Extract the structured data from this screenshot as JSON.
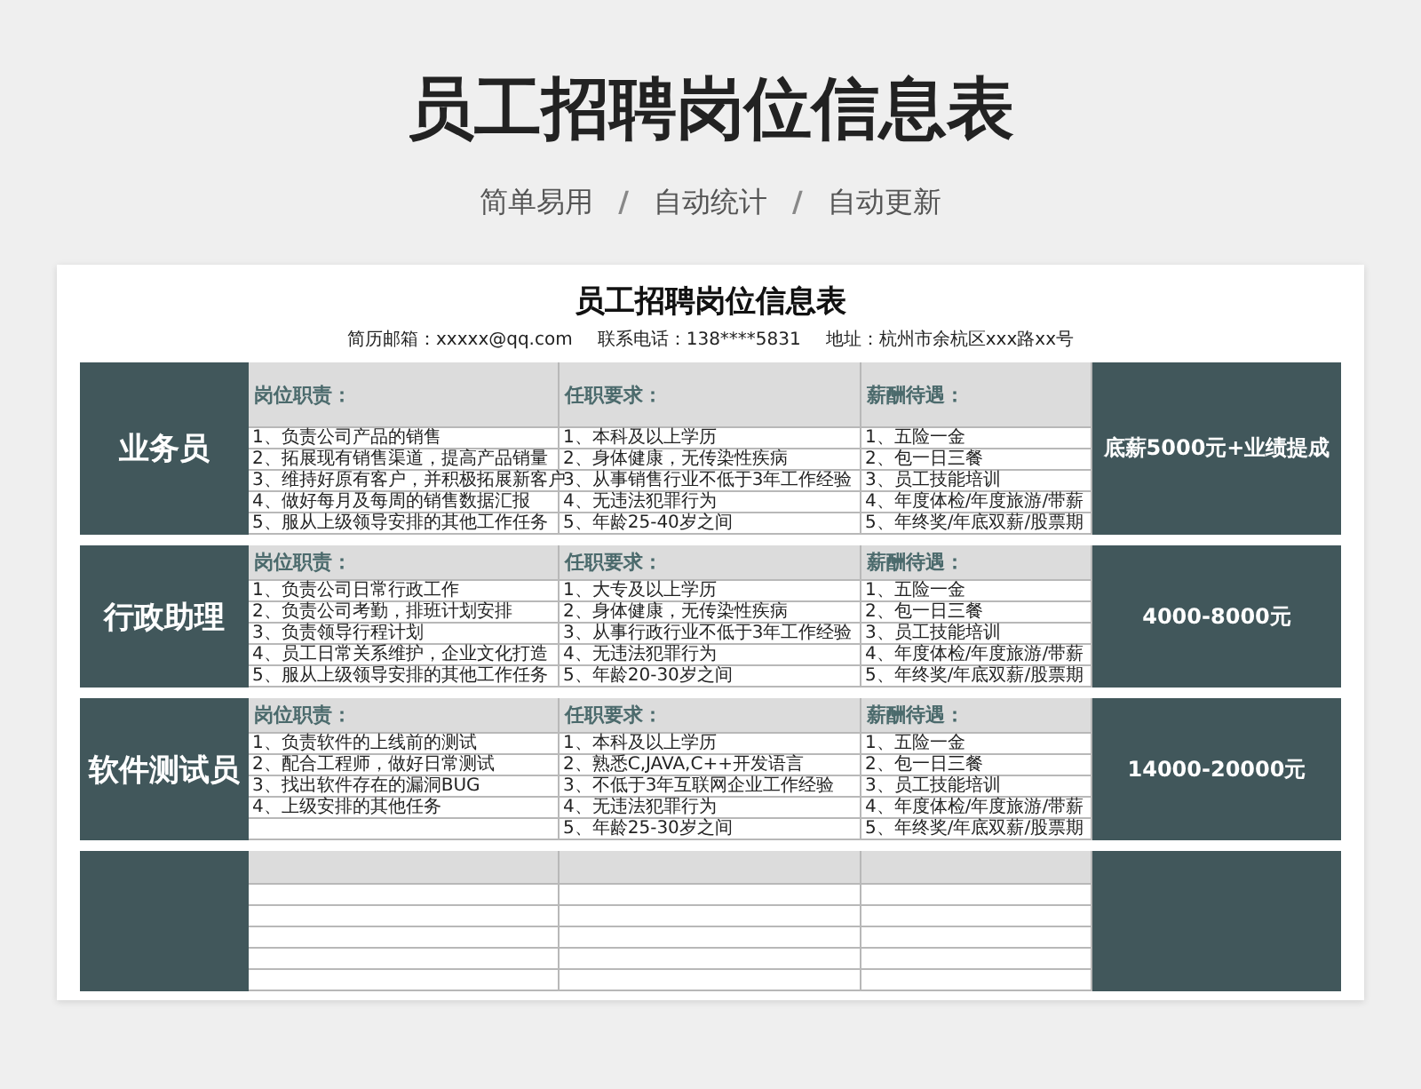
{
  "title": "员工招聘岗位信息表",
  "subtitle": [
    {
      "kind": "feature",
      "text": "简单易用"
    },
    {
      "kind": "separator",
      "text": "/"
    },
    {
      "kind": "feature",
      "text": "自动统计"
    },
    {
      "kind": "separator",
      "text": "/"
    },
    {
      "kind": "feature",
      "text": "自动更新"
    }
  ],
  "sheet": {
    "title": "员工招聘岗位信息表",
    "contact": [
      "简历邮箱：xxxxx@qq.com",
      "联系电话：138****5831",
      "地址：杭州市余杭区xxx路xx号"
    ],
    "positions": [
      {
        "kind": "filled",
        "name": "业务员",
        "headers": [
          "岗位职责：",
          "任职要求：",
          "薪酬待遇："
        ],
        "salary": "底薪5000元+业绩提成",
        "columns": [
          [
            "1、负责公司产品的销售",
            "2、拓展现有销售渠道，提高产品销量",
            "3、维持好原有客户，并积极拓展新客户",
            "4、做好每月及每周的销售数据汇报",
            "5、服从上级领导安排的其他工作任务"
          ],
          [
            "1、本科及以上学历",
            "2、身体健康，无传染性疾病",
            "3、从事销售行业不低于3年工作经验",
            "4、无违法犯罪行为",
            "5、年龄25-40岁之间"
          ],
          [
            "1、五险一金",
            "2、包一日三餐",
            "3、员工技能培训",
            "4、年度体检/年度旅游/带薪",
            "5、年终奖/年底双薪/股票期"
          ]
        ]
      },
      {
        "kind": "filled",
        "name": "行政助理",
        "headers": [
          "岗位职责：",
          "任职要求：",
          "薪酬待遇："
        ],
        "salary": "4000-8000元",
        "columns": [
          [
            "1、负责公司日常行政工作",
            "2、负责公司考勤，排班计划安排",
            "3、负责领导行程计划",
            "4、员工日常关系维护，企业文化打造",
            "5、服从上级领导安排的其他工作任务"
          ],
          [
            "1、大专及以上学历",
            "2、身体健康，无传染性疾病",
            "3、从事行政行业不低于3年工作经验",
            "4、无违法犯罪行为",
            "5、年龄20-30岁之间"
          ],
          [
            "1、五险一金",
            "2、包一日三餐",
            "3、员工技能培训",
            "4、年度体检/年度旅游/带薪",
            "5、年终奖/年底双薪/股票期"
          ]
        ]
      },
      {
        "kind": "filled",
        "name": "软件测试员",
        "headers": [
          "岗位职责：",
          "任职要求：",
          "薪酬待遇："
        ],
        "salary": "14000-20000元",
        "columns": [
          [
            "1、负责软件的上线前的测试",
            "2、配合工程师，做好日常测试",
            "3、找出软件存在的漏洞BUG",
            "4、上级安排的其他任务"
          ],
          [
            "1、本科及以上学历",
            "2、熟悉C,JAVA,C++开发语言",
            "3、不低于3年互联网企业工作经验",
            "4、无违法犯罪行为",
            "5、年龄25-30岁之间"
          ],
          [
            "1、五险一金",
            "2、包一日三餐",
            "3、员工技能培训",
            "4、年度体检/年度旅游/带薪",
            "5、年终奖/年底双薪/股票期"
          ]
        ]
      },
      {
        "kind": "blank"
      }
    ]
  }
}
